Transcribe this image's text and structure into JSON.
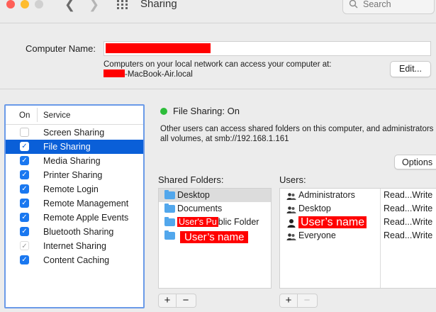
{
  "window": {
    "title": "Sharing",
    "back_icon": "chevron-left-icon",
    "forward_icon": "chevron-right-icon",
    "show_all_icon": "grid-icon",
    "traffic_lights": [
      "#ff5f57",
      "#febc2e",
      "#d0d0d0"
    ]
  },
  "search": {
    "placeholder": "Search",
    "icon": "search-icon"
  },
  "computer_name": {
    "label": "Computer Name:",
    "value": "",
    "info_line1": "Computers on your local network can access your computer at:",
    "info_line2_suffix": "-MacBook-Air.local",
    "edit_label": "Edit..."
  },
  "services": {
    "header_on": "On",
    "header_service": "Service",
    "items": [
      {
        "label": "Screen Sharing",
        "checked": false,
        "selected": false
      },
      {
        "label": "File Sharing",
        "checked": true,
        "selected": true
      },
      {
        "label": "Media Sharing",
        "checked": true,
        "selected": false
      },
      {
        "label": "Printer Sharing",
        "checked": true,
        "selected": false
      },
      {
        "label": "Remote Login",
        "checked": true,
        "selected": false
      },
      {
        "label": "Remote Management",
        "checked": true,
        "selected": false
      },
      {
        "label": "Remote Apple Events",
        "checked": true,
        "selected": false
      },
      {
        "label": "Bluetooth Sharing",
        "checked": true,
        "selected": false
      },
      {
        "label": "Internet Sharing",
        "checked": true,
        "selected": false,
        "disabled": true
      },
      {
        "label": "Content Caching",
        "checked": true,
        "selected": false
      }
    ]
  },
  "status": {
    "text": "File Sharing: On",
    "color": "#2dbd3a",
    "desc_line1": "Other users can access shared folders on this computer, and administrators",
    "desc_line2": "all volumes, at smb://192.168.1.161"
  },
  "options_label": "Options",
  "shared_folders": {
    "title": "Shared Folders:",
    "items": [
      {
        "label": "Desktop"
      },
      {
        "label": "Documents"
      },
      {
        "prefix": "User's Pu",
        "label": "blic Folder"
      },
      {
        "label": "User’s name"
      }
    ],
    "add_label": "+",
    "remove_label": "−"
  },
  "users": {
    "title": "Users:",
    "items": [
      {
        "label": "Administrators",
        "permission": "Read...Write",
        "icon": "group-icon"
      },
      {
        "label": "Desktop",
        "permission": "Read...Write",
        "icon": "group-icon"
      },
      {
        "label": "User’s name",
        "permission": "Read...Write",
        "icon": "person-icon"
      },
      {
        "label": "Everyone",
        "permission": "Read...Write",
        "icon": "group-icon"
      }
    ],
    "add_label": "+",
    "remove_label": "−"
  }
}
